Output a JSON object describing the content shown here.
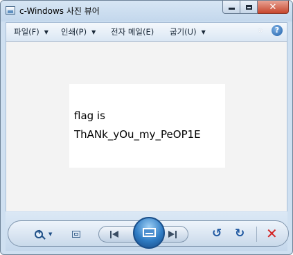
{
  "window": {
    "title": "c-Windows 사진 뷰어",
    "icon": "photo-viewer-icon",
    "caption_buttons": [
      "minimize-icon",
      "maximize-icon",
      "close-icon"
    ]
  },
  "menu": {
    "file": "파일(F)",
    "print": "인쇄(P)",
    "email": "전자 메일(E)",
    "burn": "굽기(U)",
    "more_glyph": "»",
    "help_glyph": "?"
  },
  "photo": {
    "line1": "flag is",
    "line2": "ThANk_yOu_my_PeOP1E"
  },
  "toolbar": {
    "icons": [
      "zoom-icon",
      "fit-window-icon",
      "previous-icon",
      "slideshow-icon",
      "next-icon",
      "rotate-counterclockwise-icon",
      "rotate-clockwise-icon",
      "delete-icon"
    ]
  },
  "colors": {
    "chrome": "#cfe0f1",
    "close_button": "#c7462d",
    "slideshow_button": "#2f7cc4",
    "delete": "#d42424",
    "viewer_background": "#f3f3f3"
  }
}
